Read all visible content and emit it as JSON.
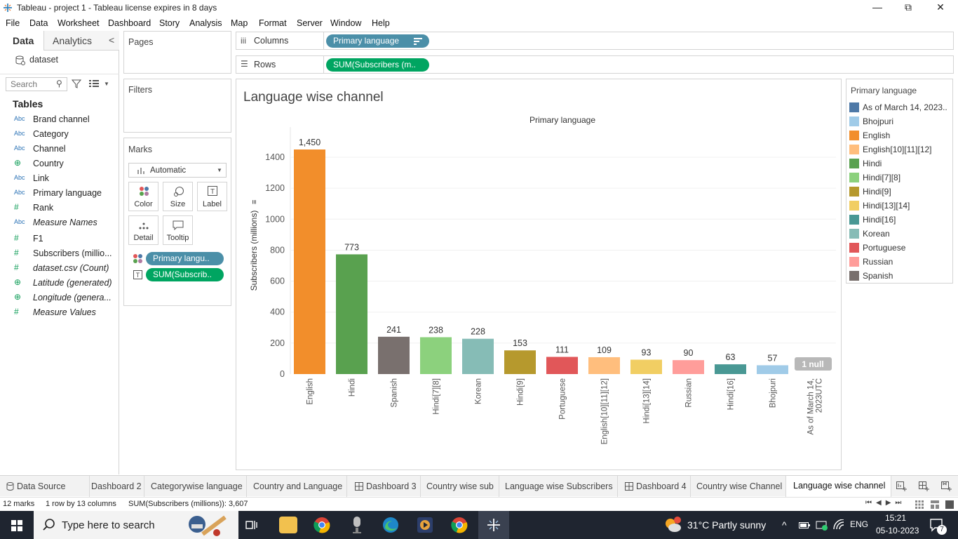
{
  "window": {
    "title": "Tableau - project 1 - Tableau license expires in 8 days",
    "minimize": "—",
    "restore": "⧉",
    "close": "✕"
  },
  "menu": [
    "File",
    "Data",
    "Worksheet",
    "Dashboard",
    "Story",
    "Analysis",
    "Map",
    "Format",
    "Server",
    "Window",
    "Help"
  ],
  "sidebar": {
    "tab_data": "Data",
    "tab_analytics": "Analytics",
    "collapse": "<",
    "datasource": "dataset",
    "search_placeholder": "Search",
    "tables_header": "Tables",
    "fields": [
      {
        "type": "Abc",
        "name": "Brand channel",
        "italic": false
      },
      {
        "type": "Abc",
        "name": "Category",
        "italic": false
      },
      {
        "type": "Abc",
        "name": "Channel",
        "italic": false
      },
      {
        "type": "geo",
        "name": "Country",
        "italic": false
      },
      {
        "type": "Abc",
        "name": "Link",
        "italic": false
      },
      {
        "type": "Abc",
        "name": "Primary language",
        "italic": false
      },
      {
        "type": "#",
        "name": "Rank",
        "italic": false
      },
      {
        "type": "Abc",
        "name": "Measure Names",
        "italic": true
      },
      {
        "type": "#",
        "name": "F1",
        "italic": false
      },
      {
        "type": "#",
        "name": "Subscribers (millio...",
        "italic": false
      },
      {
        "type": "#",
        "name": "dataset.csv (Count)",
        "italic": true
      },
      {
        "type": "geo",
        "name": "Latitude (generated)",
        "italic": true
      },
      {
        "type": "geo",
        "name": "Longitude (genera...",
        "italic": true
      },
      {
        "type": "#",
        "name": "Measure Values",
        "italic": true
      }
    ]
  },
  "pages": {
    "title": "Pages"
  },
  "filters": {
    "title": "Filters"
  },
  "marks": {
    "title": "Marks",
    "type": "Automatic",
    "buttons": [
      {
        "label": "Color"
      },
      {
        "label": "Size"
      },
      {
        "label": "Label"
      },
      {
        "label": "Detail"
      },
      {
        "label": "Tooltip"
      }
    ],
    "pills": [
      "Primary langu..",
      "SUM(Subscrib.."
    ]
  },
  "shelves": {
    "columns_label": "Columns",
    "columns_pill": "Primary language",
    "rows_label": "Rows",
    "rows_pill": "SUM(Subscribers (m.."
  },
  "view": {
    "title": "Language wise channel"
  },
  "chart_data": {
    "type": "bar",
    "title": "Language wise channel",
    "xlabel": "Primary language",
    "ylabel": "Subscribers (millions)",
    "ylim": [
      0,
      1500
    ],
    "yticks": [
      0,
      200,
      400,
      600,
      800,
      1000,
      1200,
      1400
    ],
    "grid": true,
    "categories": [
      "English",
      "Hindi",
      "Spanish",
      "Hindi[7][8]",
      "Korean",
      "Hindi[9]",
      "Portuguese",
      "English[10][11][12]",
      "Hindi[13][14]",
      "Russian",
      "Hindi[16]",
      "Bhojpuri",
      "As of March 14, 2023UTC"
    ],
    "values": [
      1450,
      773,
      241,
      238,
      228,
      153,
      111,
      109,
      93,
      90,
      63,
      57,
      null
    ],
    "value_labels": [
      "1,450",
      "773",
      "241",
      "238",
      "228",
      "153",
      "111",
      "109",
      "93",
      "90",
      "63",
      "57",
      ""
    ],
    "colors": [
      "#f28e2b",
      "#59a14f",
      "#79706e",
      "#8cd17d",
      "#86bcb6",
      "#b6992d",
      "#e15759",
      "#ffbe7d",
      "#f1ce63",
      "#ff9d9a",
      "#499894",
      "#a0cbe8",
      "#4e79a7"
    ],
    "null_indicator": "1 null"
  },
  "legend": {
    "title": "Primary language",
    "items": [
      {
        "label": "As of March 14, 2023..",
        "color": "#4e79a7"
      },
      {
        "label": "Bhojpuri",
        "color": "#a0cbe8"
      },
      {
        "label": "English",
        "color": "#f28e2b"
      },
      {
        "label": "English[10][11][12]",
        "color": "#ffbe7d"
      },
      {
        "label": "Hindi",
        "color": "#59a14f"
      },
      {
        "label": "Hindi[7][8]",
        "color": "#8cd17d"
      },
      {
        "label": "Hindi[9]",
        "color": "#b6992d"
      },
      {
        "label": "Hindi[13][14]",
        "color": "#f1ce63"
      },
      {
        "label": "Hindi[16]",
        "color": "#499894"
      },
      {
        "label": "Korean",
        "color": "#86bcb6"
      },
      {
        "label": "Portuguese",
        "color": "#e15759"
      },
      {
        "label": "Russian",
        "color": "#ff9d9a"
      },
      {
        "label": "Spanish",
        "color": "#79706e"
      }
    ]
  },
  "tabs": [
    {
      "label": "Data Source",
      "kind": "datasource",
      "active": false
    },
    {
      "label": "Dashboard 2",
      "kind": "sheet",
      "active": false
    },
    {
      "label": "Categorywise language",
      "kind": "sheet",
      "active": false
    },
    {
      "label": "Country and Language",
      "kind": "sheet",
      "active": false
    },
    {
      "label": "Dashboard 3",
      "kind": "dashboard",
      "active": false
    },
    {
      "label": "Country wise sub",
      "kind": "sheet",
      "active": false
    },
    {
      "label": "Language wise Subscribers",
      "kind": "sheet",
      "active": false
    },
    {
      "label": "Dashboard 4",
      "kind": "dashboard",
      "active": false
    },
    {
      "label": "Country wise Channel",
      "kind": "sheet",
      "active": false
    },
    {
      "label": "Language wise channel",
      "kind": "sheet",
      "active": true
    }
  ],
  "status": {
    "marks": "12 marks",
    "dims": "1 row by 13 columns",
    "sum": "SUM(Subscribers (millions)): 3,607"
  },
  "taskbar": {
    "search_placeholder": "Type here to search",
    "weather": "31°C  Partly sunny",
    "lang": "ENG",
    "time": "15:21",
    "date": "05-10-2023",
    "notif": "7"
  }
}
